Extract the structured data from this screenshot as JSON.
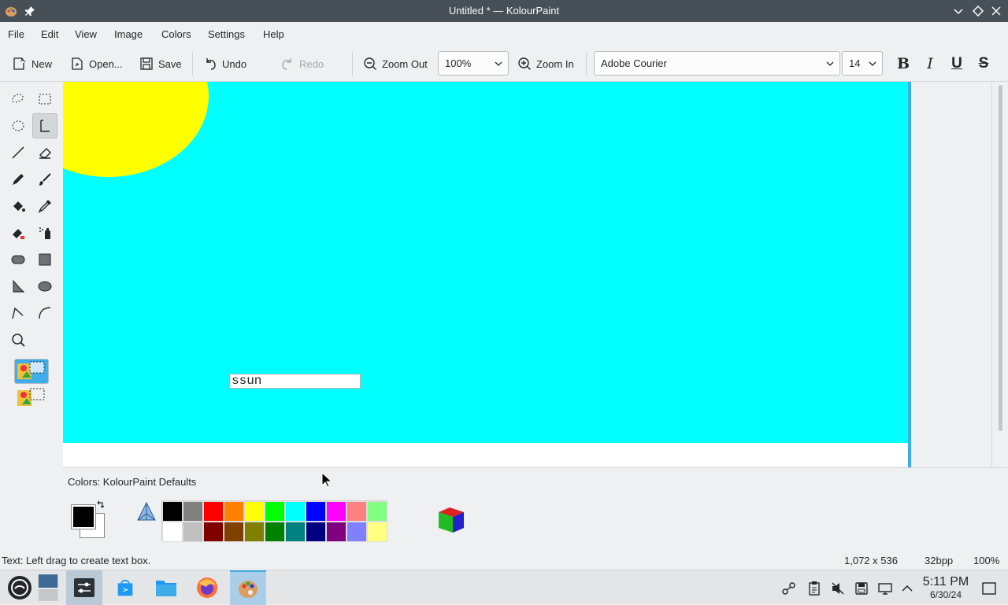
{
  "window": {
    "title": "Untitled * — KolourPaint",
    "app_icon": "kolourpaint-icon",
    "pin_icon": "pin-icon"
  },
  "menu": [
    "File",
    "Edit",
    "View",
    "Image",
    "Colors",
    "Settings",
    "Help"
  ],
  "toolbar": {
    "new": "New",
    "open": "Open...",
    "save": "Save",
    "undo": "Undo",
    "redo": "Redo",
    "zoom_out": "Zoom Out",
    "zoom_value": "100%",
    "zoom_in": "Zoom In",
    "font": "Adobe Courier",
    "font_size": "14",
    "bold": "B",
    "italic": "I",
    "underline": "U",
    "strike": "S"
  },
  "tools": [
    "free-form-selection",
    "rectangular-selection",
    "elliptical-selection",
    "text",
    "line",
    "eraser",
    "pen",
    "brush",
    "flood-fill",
    "color-picker",
    "color-eraser",
    "spraycan",
    "rounded-rectangle",
    "rectangle",
    "polygon",
    "ellipse",
    "polyline",
    "curve",
    "zoom"
  ],
  "canvas": {
    "text_box": "ssun",
    "sky_color": "#00ffff",
    "sun_color": "#ffff00"
  },
  "colors": {
    "label": "Colors: KolourPaint Defaults",
    "foreground": "#000000",
    "background": "#ffffff",
    "row1": [
      "#000000",
      "#808080",
      "#ff0000",
      "#ff8000",
      "#ffff00",
      "#00ff00",
      "#00ffff",
      "#0000ff",
      "#ff00ff",
      "#ff8080",
      "#80ff80"
    ],
    "row2": [
      "#ffffff",
      "#c0c0c0",
      "#800000",
      "#804000",
      "#808000",
      "#008000",
      "#008080",
      "#000080",
      "#800080",
      "#8080ff",
      "#ffff80"
    ]
  },
  "status": {
    "message": "Text: Left drag to create text box.",
    "size": "1,072 x 536",
    "depth": "32bpp",
    "zoom": "100%"
  },
  "clock": {
    "time": "5:11 PM",
    "date": "6/30/24"
  }
}
